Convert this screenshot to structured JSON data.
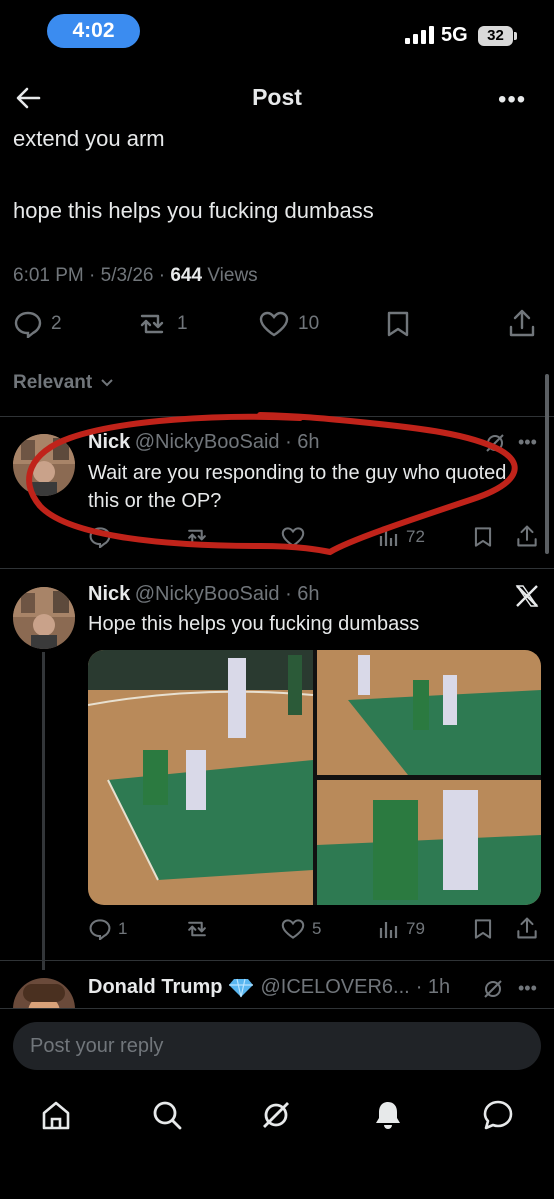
{
  "status_bar": {
    "time": "4:02",
    "network": "5G",
    "battery": "32"
  },
  "header": {
    "title": "Post"
  },
  "post": {
    "line1": "extend you arm",
    "line2": "hope this helps you fucking dumbass",
    "timestamp": "6:01 PM · 5/3/26 · ",
    "views_count": "644",
    "views_label": " Views",
    "replies": "2",
    "reposts": "1",
    "likes": "10"
  },
  "sort": {
    "label": "Relevant"
  },
  "replies": [
    {
      "name": "Nick",
      "handle": "@NickyBooSaid",
      "time": " · 6h",
      "text": "Wait are you responding to the guy who quoted this or the OP?",
      "views": "72"
    },
    {
      "name": "Nick",
      "handle": "@NickyBooSaid",
      "time": " · 6h",
      "text": "Hope this helps you fucking dumbass",
      "replies": "1",
      "likes": "5",
      "views": "79"
    },
    {
      "name": "Donald Trump",
      "handle": "@ICELOVER6...",
      "time": " · 1h"
    }
  ],
  "composer": {
    "placeholder": "Post your reply"
  },
  "colors": {
    "accent": "#3b8cf0",
    "annotation": "#c0231a",
    "muted": "#71767b"
  }
}
